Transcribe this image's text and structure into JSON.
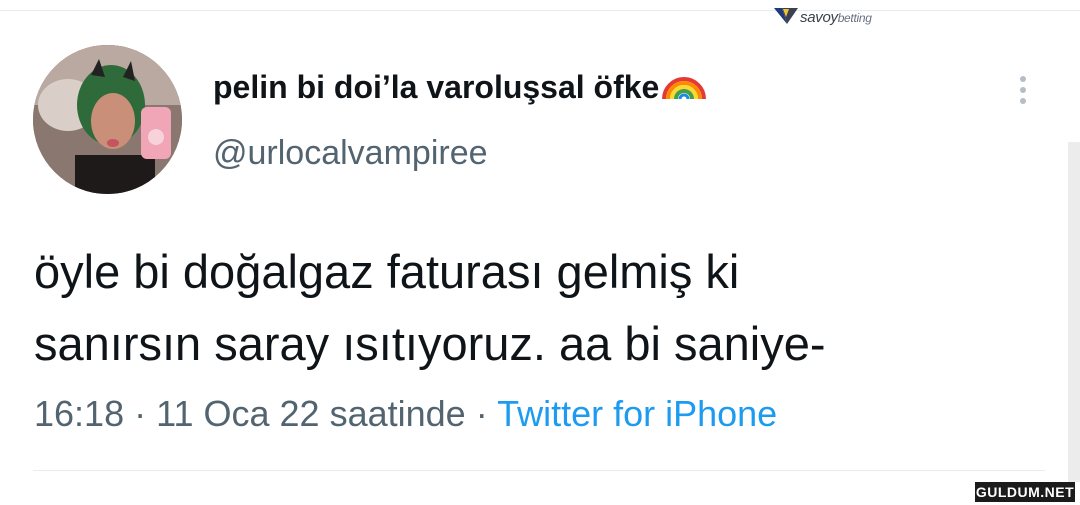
{
  "watermark": {
    "brand": "savoy",
    "brand_suffix": "betting"
  },
  "tweet": {
    "display_name": "pelin bi doi’la varoluşsal öfke",
    "handle": "@urlocalvampiree",
    "text_lines": [
      "öyle bi doğalgaz faturası gelmiş ki",
      "sanırsın saray ısıtıyoruz. aa bi saniye-"
    ],
    "time": "16:18",
    "date": "11 Oca 22 saatinde",
    "separator": "·",
    "source": "Twitter for iPhone"
  },
  "site_tag": "GULDUM.NET",
  "icons": {
    "name_emoji": "rainbow-icon",
    "menu": "more-options-icon",
    "avatar": "avatar-photo"
  },
  "colors": {
    "text": "#0f1419",
    "secondary": "#536471",
    "link": "#1d9bf0"
  }
}
